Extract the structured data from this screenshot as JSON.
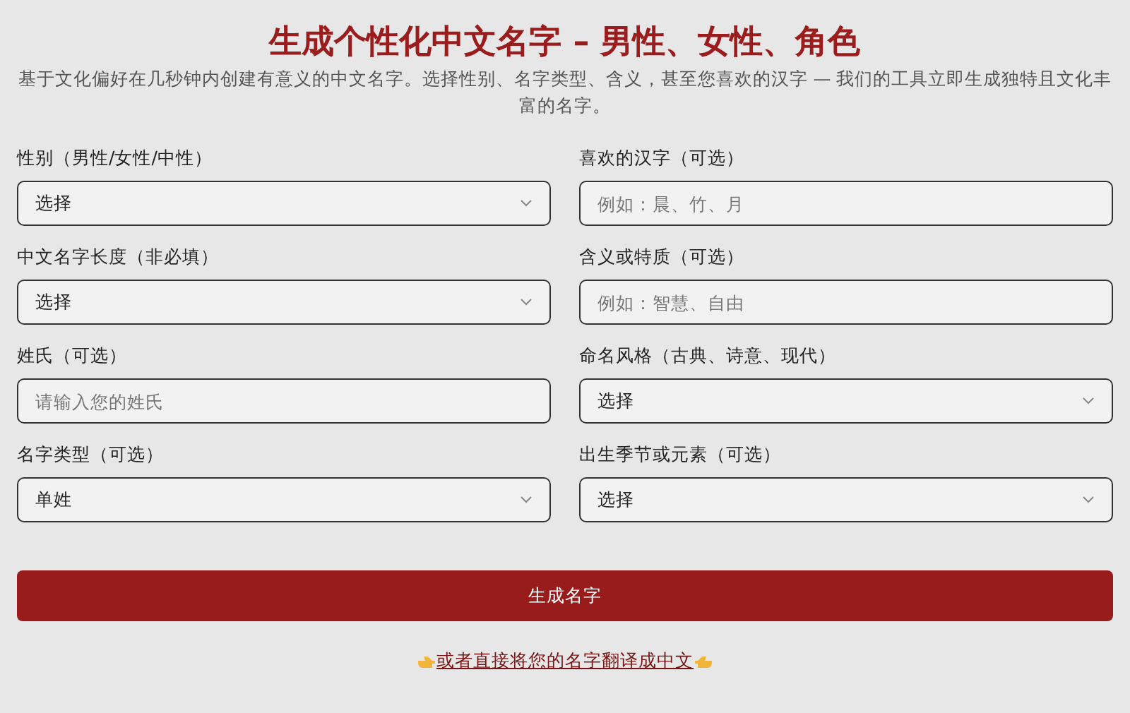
{
  "title": "生成个性化中文名字 – 男性、女性、角色",
  "subtitle": "基于文化偏好在几秒钟内创建有意义的中文名字。选择性别、名字类型、含义，甚至您喜欢的汉字 — 我们的工具立即生成独特且文化丰富的名字。",
  "fields": [
    {
      "kind": "select",
      "label": "性别（男性/女性/中性）",
      "value": "选择"
    },
    {
      "kind": "input",
      "label": "喜欢的汉字（可选）",
      "placeholder": "例如：晨、竹、月"
    },
    {
      "kind": "select",
      "label": "中文名字长度（非必填）",
      "value": "选择"
    },
    {
      "kind": "input",
      "label": "含义或特质（可选）",
      "placeholder": "例如：智慧、自由"
    },
    {
      "kind": "input",
      "label": "姓氏（可选）",
      "placeholder": "请输入您的姓氏"
    },
    {
      "kind": "select",
      "label": "命名风格（古典、诗意、现代）",
      "value": "选择"
    },
    {
      "kind": "select",
      "label": "名字类型（可选）",
      "value": "单姓"
    },
    {
      "kind": "select",
      "label": "出生季节或元素（可选）",
      "value": "选择"
    }
  ],
  "submit": "生成名字",
  "link": "或者直接将您的名字翻译成中文"
}
